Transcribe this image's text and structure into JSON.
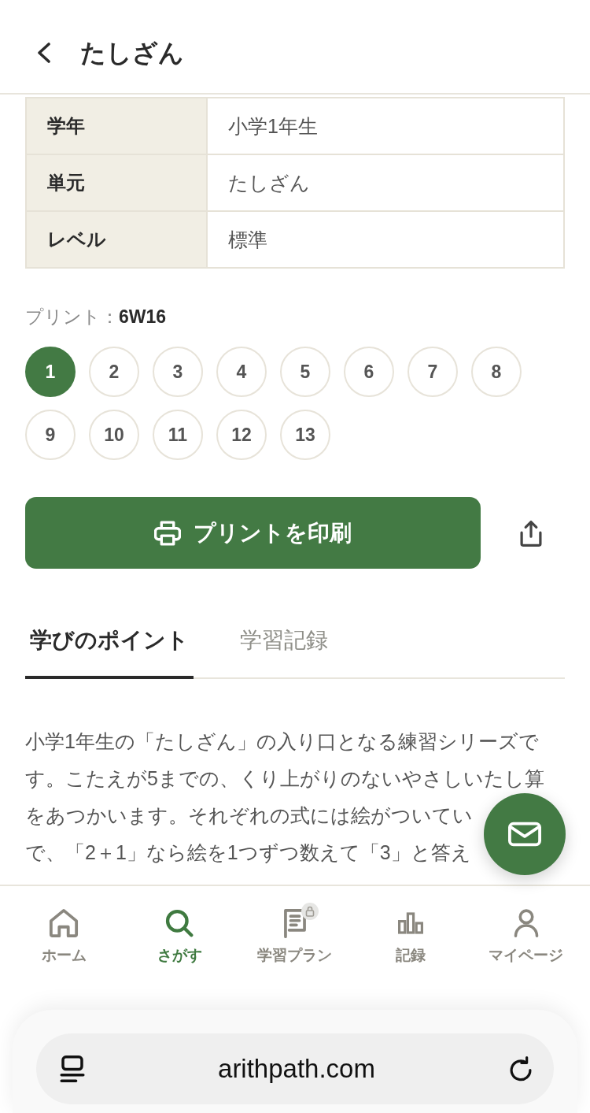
{
  "header": {
    "title": "たしざん"
  },
  "info_table": {
    "rows": [
      {
        "label": "学年",
        "value": "小学1年生"
      },
      {
        "label": "単元",
        "value": "たしざん"
      },
      {
        "label": "レベル",
        "value": "標準"
      }
    ]
  },
  "prints": {
    "label": "プリント：**6W16**",
    "items": [
      {
        "label": "1",
        "selected": true
      },
      {
        "label": "2",
        "selected": false
      },
      {
        "label": "3",
        "selected": false
      },
      {
        "label": "4",
        "selected": false
      },
      {
        "label": "5",
        "selected": false
      },
      {
        "label": "6",
        "selected": false
      },
      {
        "label": "7",
        "selected": false
      },
      {
        "label": "8",
        "selected": false
      },
      {
        "label": "9",
        "selected": false
      },
      {
        "label": "10",
        "selected": false
      },
      {
        "label": "11",
        "selected": false
      },
      {
        "label": "12",
        "selected": false
      },
      {
        "label": "13",
        "selected": false
      }
    ]
  },
  "print_button": {
    "label": "プリントを印刷"
  },
  "tabs": [
    {
      "label": "学びのポイント",
      "selected": true
    },
    {
      "label": "学習記録",
      "selected": false
    }
  ],
  "description": {
    "lines": [
      "小学1年生の「たしざん」の入り口となる練習シリーズで",
      "す。こたえが5までの、くり上がりのないやさしいたし算",
      "をあつかいます。それぞれの式には絵がついてい",
      "で、「2＋1」なら絵を1つずつ数えて「3」と答え"
    ]
  },
  "bottom_nav": {
    "items": [
      {
        "kind": "home",
        "label": "ホーム",
        "selected": false,
        "locked": false
      },
      {
        "kind": "search",
        "label": "さがす",
        "selected": true,
        "locked": false
      },
      {
        "kind": "plan",
        "label": "学習プラン",
        "selected": false,
        "locked": true
      },
      {
        "kind": "records",
        "label": "記録",
        "selected": false,
        "locked": false
      },
      {
        "kind": "mypage",
        "label": "マイページ",
        "selected": false,
        "locked": false
      }
    ]
  },
  "browser": {
    "url": "arithpath.com"
  }
}
